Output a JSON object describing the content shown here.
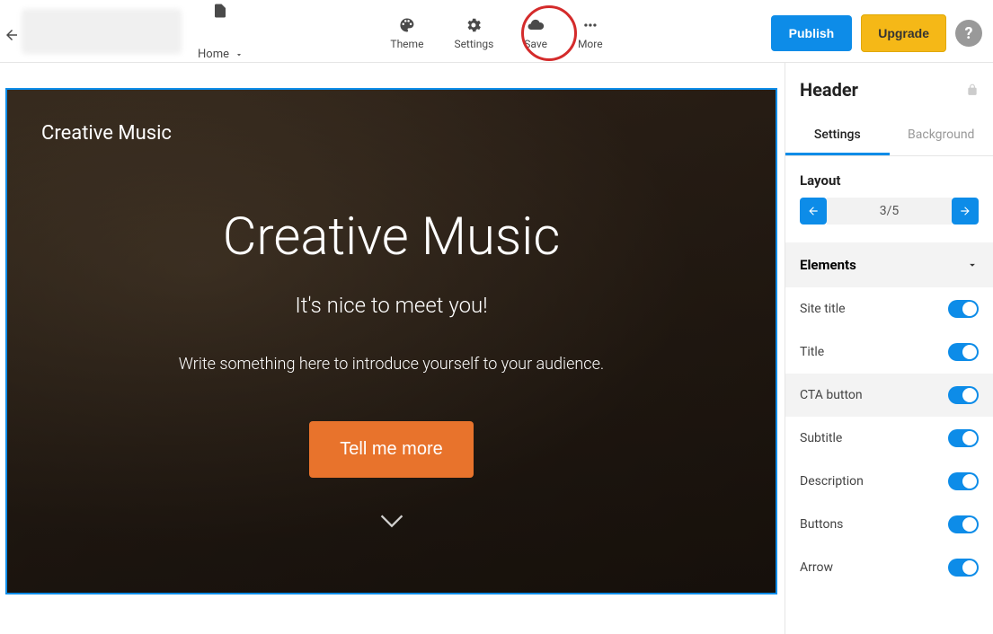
{
  "toolbar": {
    "home_label": "Home",
    "theme_label": "Theme",
    "settings_label": "Settings",
    "save_label": "Save",
    "more_label": "More",
    "publish_label": "Publish",
    "upgrade_label": "Upgrade"
  },
  "canvas": {
    "site_title": "Creative Music",
    "hero_title": "Creative Music",
    "hero_subtitle": "It's nice to meet you!",
    "hero_description": "Write something here to introduce yourself to your audience.",
    "cta_label": "Tell me more"
  },
  "sidebar": {
    "title": "Header",
    "tabs": {
      "settings": "Settings",
      "background": "Background"
    },
    "layout_label": "Layout",
    "layout_counter": "3/5",
    "elements_label": "Elements",
    "elements": [
      {
        "label": "Site title",
        "on": true
      },
      {
        "label": "Title",
        "on": true
      },
      {
        "label": "CTA button",
        "on": true,
        "selected": true
      },
      {
        "label": "Subtitle",
        "on": true
      },
      {
        "label": "Description",
        "on": true
      },
      {
        "label": "Buttons",
        "on": true
      },
      {
        "label": "Arrow",
        "on": true
      }
    ]
  }
}
